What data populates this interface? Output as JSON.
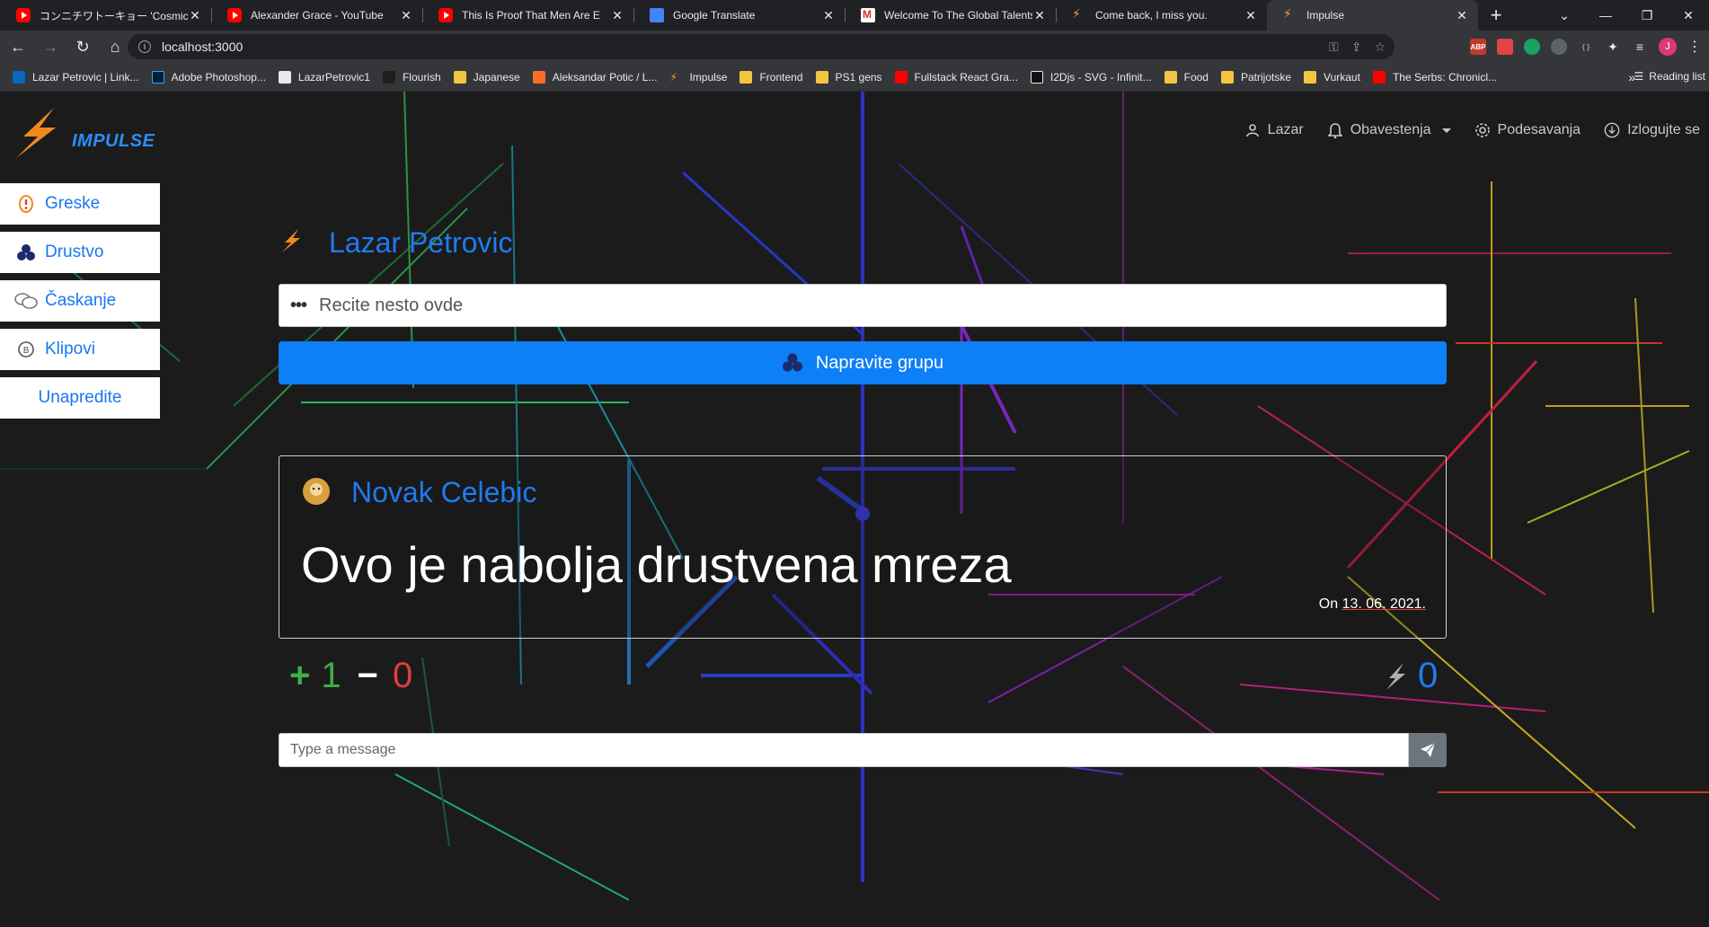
{
  "browser": {
    "tabs": [
      {
        "title": "コンニチワトーキョー 'Cosmic Girl' Of",
        "icon": "youtube-icon"
      },
      {
        "title": "Alexander Grace - YouTube",
        "icon": "youtube-icon"
      },
      {
        "title": "This Is Proof That Men Are E",
        "icon": "youtube-icon"
      },
      {
        "title": "Google Translate",
        "icon": "google-translate-icon"
      },
      {
        "title": "Welcome To The Global Talents",
        "icon": "gmail-icon"
      },
      {
        "title": "Come back, I miss you.",
        "icon": "impulse-icon"
      },
      {
        "title": "Impulse",
        "icon": "impulse-icon"
      }
    ],
    "new_tab": "+",
    "url": "localhost:3000",
    "bookmarks": [
      {
        "label": "Lazar Petrovic | Link...",
        "icon": "linkedin-icon"
      },
      {
        "label": "Adobe Photoshop...",
        "icon": "photoshop-icon"
      },
      {
        "label": "LazarPetrovic1",
        "icon": "github-icon"
      },
      {
        "label": "Flourish",
        "icon": "flourish-icon"
      },
      {
        "label": "Japanese",
        "icon": "folder-icon"
      },
      {
        "label": "Aleksandar Potic / L...",
        "icon": "gitlab-icon"
      },
      {
        "label": "Impulse",
        "icon": "impulse-icon"
      },
      {
        "label": "Frontend",
        "icon": "folder-icon"
      },
      {
        "label": "PS1 gens",
        "icon": "folder-icon"
      },
      {
        "label": "Fullstack React Gra...",
        "icon": "youtube-icon"
      },
      {
        "label": "I2Djs - SVG - Infinit...",
        "icon": "svg-icon"
      },
      {
        "label": "Food",
        "icon": "folder-icon"
      },
      {
        "label": "Patrijotske",
        "icon": "folder-icon"
      },
      {
        "label": "Vurkaut",
        "icon": "folder-icon"
      },
      {
        "label": "The Serbs: Chronicl...",
        "icon": "youtube-icon"
      }
    ],
    "bookmarks_more": "»",
    "reading_list": "Reading list",
    "profile_initial": "J",
    "extensions": [
      "ABP"
    ]
  },
  "app": {
    "logo_text": "IMPULSE",
    "nav": {
      "user": "Lazar",
      "notifications": "Obavestenja",
      "settings": "Podesavanja",
      "logout": "Izlogujte se"
    },
    "sidebar": [
      {
        "label": "Greske",
        "icon": "bug-icon"
      },
      {
        "label": "Drustvo",
        "icon": "group-icon"
      },
      {
        "label": "Časkanje",
        "icon": "chat-icon"
      },
      {
        "label": "Klipovi",
        "icon": "video-icon"
      },
      {
        "label": "Unapredite",
        "icon": ""
      }
    ],
    "profile_name": "Lazar Petrovic",
    "post_placeholder": "Recite nesto ovde",
    "group_button": "Napravite grupu",
    "post": {
      "author": "Novak Celebic",
      "text": "Ovo je nabolja drustvena mreza",
      "date_prefix": "On",
      "date": "13. 06. 2021."
    },
    "votes": {
      "plus": "+",
      "up": "1",
      "minus": "−",
      "down": "0",
      "impulse_count": "0"
    },
    "message_placeholder": "Type a message"
  },
  "colors": {
    "accent_blue": "#1f7bf0",
    "button_blue": "#0d7ff7",
    "upvote_green": "#3cb043",
    "downvote_red": "#e23c3c",
    "logo_orange": "#f0a030"
  }
}
